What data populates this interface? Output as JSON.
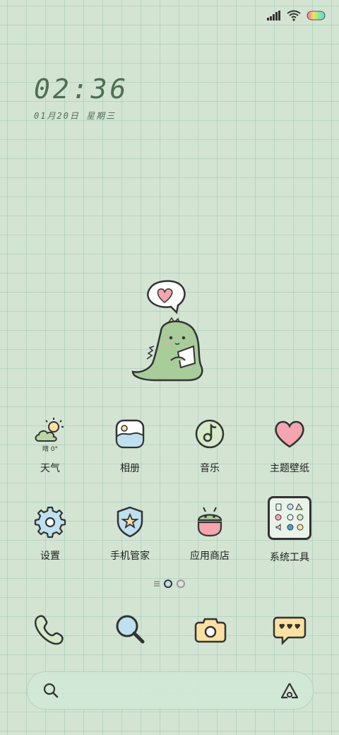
{
  "status_bar": {
    "icons": [
      "signal-icon",
      "wifi-icon",
      "battery-icon"
    ]
  },
  "clock": {
    "time": "02:36",
    "date": "01月20日  星期三"
  },
  "weather": {
    "condition": "晴",
    "temp": "0°"
  },
  "apps": [
    {
      "label": "天气",
      "icon": "weather-icon"
    },
    {
      "label": "相册",
      "icon": "gallery-icon"
    },
    {
      "label": "音乐",
      "icon": "music-icon"
    },
    {
      "label": "主题壁纸",
      "icon": "heart-icon"
    },
    {
      "label": "设置",
      "icon": "gear-icon"
    },
    {
      "label": "手机管家",
      "icon": "shield-star-icon"
    },
    {
      "label": "应用商店",
      "icon": "android-store-icon"
    },
    {
      "label": "系统工具",
      "icon": "tools-folder-icon"
    }
  ],
  "page_indicator": {
    "pages": 2,
    "current": 1
  },
  "dock": [
    "phone-icon",
    "browser-search-icon",
    "camera-icon",
    "message-icon"
  ],
  "search_bar": {
    "icons": [
      "search-icon",
      "assistant-icon"
    ]
  },
  "colors": {
    "background": "#d3e4d3",
    "grid": "#8fb8ab",
    "clock": "#4d6f52",
    "accent_pink": "#f4a5ae",
    "accent_blue": "#bfe0ee",
    "accent_yellow": "#fbe0a3"
  }
}
